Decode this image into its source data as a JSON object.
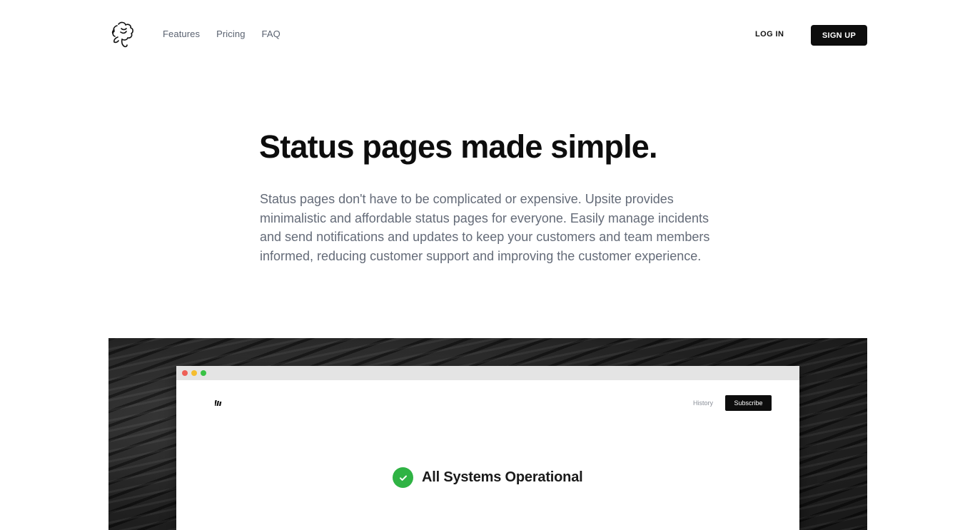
{
  "nav": {
    "logo_icon": "hand-flower-logo-icon",
    "links": [
      "Features",
      "Pricing",
      "FAQ"
    ],
    "login_label": "LOG IN",
    "signup_label": "SIGN UP"
  },
  "hero": {
    "title": "Status pages made simple.",
    "description": "Status pages don't have to be complicated or expensive. Upsite provides minimalistic and affordable status pages for everyone. Easily manage incidents and send notifications and updates to keep your customers and team members informed, reducing customer support and improving the customer experience."
  },
  "preview": {
    "window_dots": [
      "#ee5f56",
      "#f5bd2f",
      "#38c245"
    ],
    "mini_logo_icon": "bars-logo-icon",
    "history_label": "History",
    "subscribe_label": "Subscribe",
    "status_icon": "check-circle-icon",
    "status_color": "#2fb344",
    "status_text": "All Systems Operational"
  }
}
